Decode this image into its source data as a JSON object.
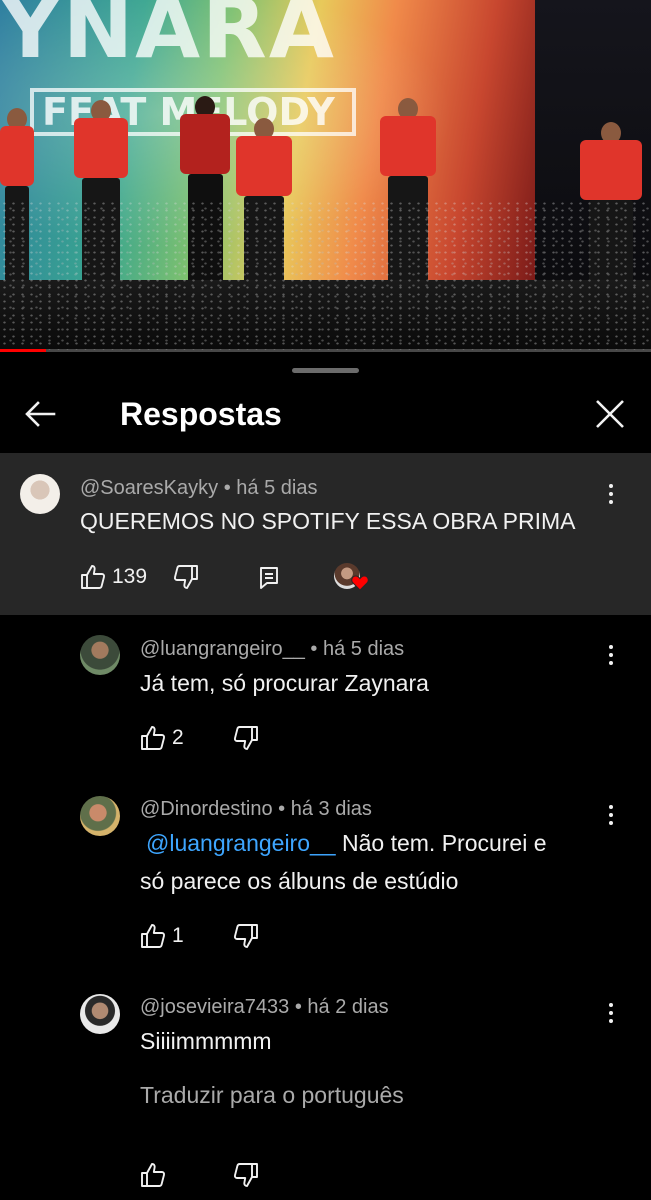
{
  "video": {
    "banner_text": "YNARA",
    "banner_sub": "FEAT MELODY",
    "progress_fraction": 0.07,
    "accent_color": "#ff0000"
  },
  "panel": {
    "title": "Respostas",
    "back_icon": "arrow-left-icon",
    "close_icon": "close-icon"
  },
  "parent_comment": {
    "author": "@SoaresKayky",
    "time": "há 5 dias",
    "text": "QUEREMOS NO SPOTIFY ESSA OBRA PRIMA",
    "likes": "139",
    "creator_heart": true
  },
  "replies": [
    {
      "author": "@luangrangeiro__",
      "time": "há 5 dias",
      "text": "Já tem, só procurar Zaynara",
      "likes": "2"
    },
    {
      "author": "@Dinordestino",
      "time": "há 3 dias",
      "mention": "@luangrangeiro__",
      "text_line1": " Não tem. Procurei e",
      "text_line2": "só parece os álbuns de estúdio",
      "likes": "1"
    },
    {
      "author": "@josevieira7433",
      "time": "há 2 dias",
      "text": "Siiiimmmmm",
      "translate": "Traduzir para o português",
      "likes": ""
    }
  ],
  "separator": " • "
}
